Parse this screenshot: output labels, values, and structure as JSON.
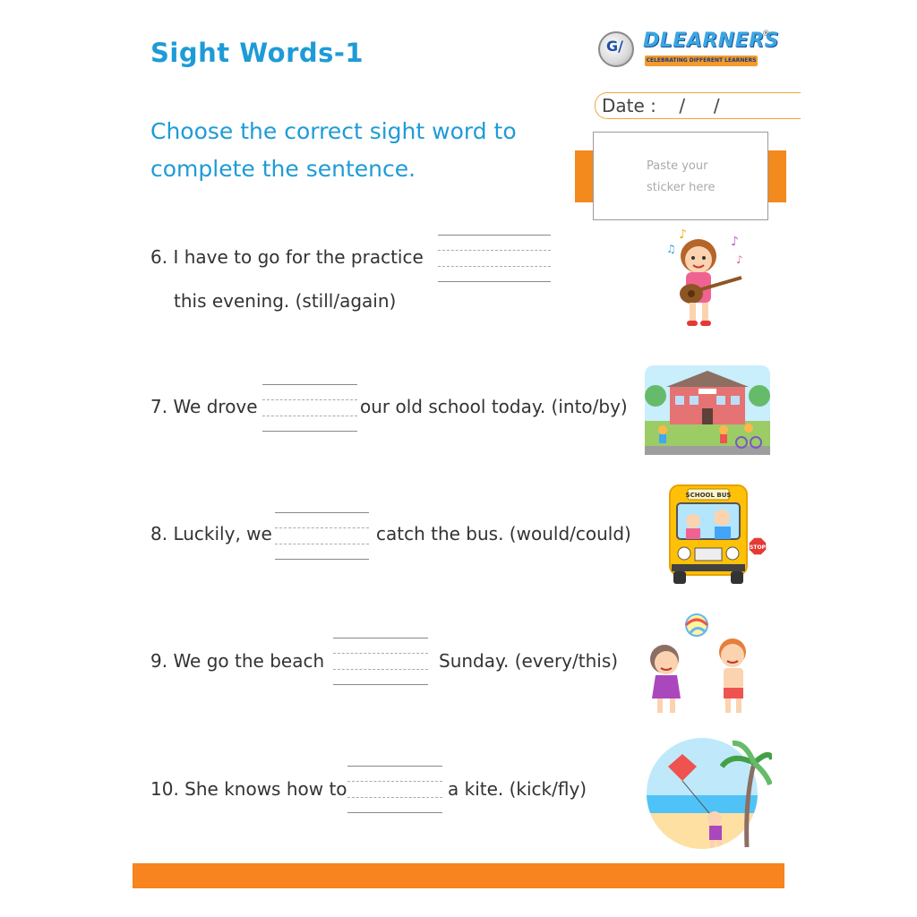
{
  "worksheet": {
    "title": "Sight Words-1",
    "instruction_line1": "Choose the correct sight word to",
    "instruction_line2": "complete the sentence."
  },
  "logo": {
    "mark": "G/",
    "wordmark": "DLEARNERS",
    "registered": "®",
    "tagline": "CELEBRATING DIFFERENT LEARNERS"
  },
  "date": {
    "label": "Date :    /     /"
  },
  "sticker": {
    "line1": "Paste your",
    "line2": "sticker here"
  },
  "questions": [
    {
      "number": "6.",
      "before": "I have to go for the practice",
      "after": "",
      "line2": "this evening. (still/again)",
      "picture": "girl-with-guitar-icon"
    },
    {
      "number": "7.",
      "before": "We drove",
      "after": "our old school today. (into/by)",
      "picture": "school-building-icon"
    },
    {
      "number": "8.",
      "before": "Luckily, we",
      "after": "catch the bus. (would/could)",
      "picture": "school-bus-icon",
      "bus_sign": "SCHOOL BUS",
      "stop_sign": "STOP"
    },
    {
      "number": "9.",
      "before": "We go the beach",
      "after": "Sunday. (every/this)",
      "picture": "kids-with-beach-ball-icon"
    },
    {
      "number": "10.",
      "before": "She knows how to",
      "after": "a kite. (kick/fly)",
      "picture": "girl-with-kite-icon"
    }
  ],
  "colors": {
    "title_blue": "#1e9bd7",
    "accent_orange": "#f7841f",
    "text_dark": "#333333"
  }
}
